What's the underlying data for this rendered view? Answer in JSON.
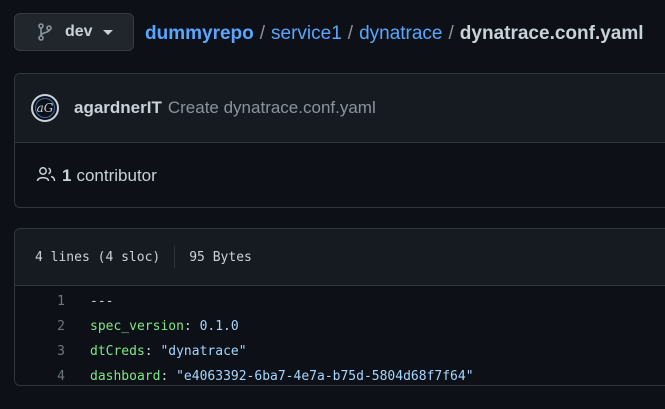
{
  "branch": {
    "name": "dev"
  },
  "breadcrumb": {
    "repo": "dummyrepo",
    "dirs": [
      "service1",
      "dynatrace"
    ],
    "file": "dynatrace.conf.yaml",
    "separator": "/"
  },
  "commit": {
    "avatar_initials": "aG",
    "author": "agardnerIT",
    "message": "Create dynatrace.conf.yaml"
  },
  "contributors": {
    "count": "1",
    "label": "contributor"
  },
  "file_info": {
    "lines": "4 lines (4 sloc)",
    "size": "95 Bytes"
  },
  "code": {
    "lines": [
      {
        "num": "1",
        "key": "",
        "sep": "",
        "value": "---"
      },
      {
        "num": "2",
        "key": "spec_version",
        "sep": ": ",
        "value": "0.1.0"
      },
      {
        "num": "3",
        "key": "dtCreds",
        "sep": ": ",
        "value": "\"dynatrace\""
      },
      {
        "num": "4",
        "key": "dashboard",
        "sep": ": ",
        "value": "\"e4063392-6ba7-4e7a-b75d-5804d68f7f64\""
      }
    ]
  }
}
